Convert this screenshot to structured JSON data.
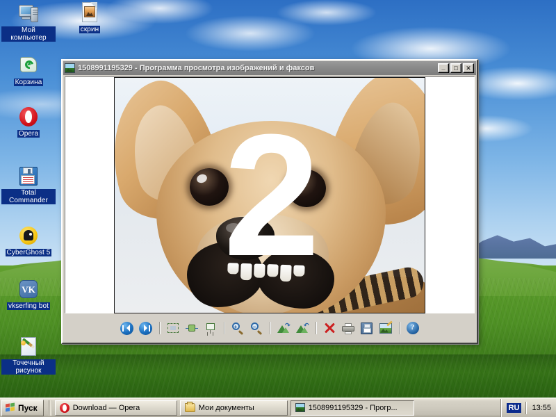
{
  "desktop": {
    "icons": [
      {
        "name": "my-computer",
        "label": "Мой компьютер",
        "icon": "computer-icon"
      },
      {
        "name": "recycle-bin",
        "label": "Корзина",
        "icon": "recycle-bin-icon"
      },
      {
        "name": "opera",
        "label": "Opera",
        "icon": "opera-icon"
      },
      {
        "name": "total-commander",
        "label": "Total Commander",
        "icon": "floppy-disk-icon"
      },
      {
        "name": "cyberghost",
        "label": "CyberGhost 5",
        "icon": "ghost-icon"
      },
      {
        "name": "vkserfing-bot",
        "label": "vkserfing bot",
        "icon": "vk-icon"
      },
      {
        "name": "bitmap-image",
        "label": "Точечный рисунок",
        "icon": "paint-brush-icon"
      },
      {
        "name": "screenshot-file",
        "label": "скрин",
        "icon": "image-file-icon"
      }
    ]
  },
  "viewer": {
    "title": "1508991195329 - Программа просмотра изображений и факсов",
    "title_icon": "picture-icon",
    "window_buttons": {
      "minimize": "_",
      "maximize": "□",
      "close": "✕"
    },
    "image": {
      "overlay_text": "2",
      "alt": "Чихуахуа крупным планом"
    },
    "toolbar": [
      {
        "name": "previous-image-button",
        "icon": "previous-icon",
        "tooltip": "Предыдущее изображение"
      },
      {
        "name": "next-image-button",
        "icon": "next-icon",
        "tooltip": "Следующее изображение"
      },
      {
        "name": "best-fit-button",
        "icon": "best-fit-icon",
        "tooltip": "Наилучшее соответствие"
      },
      {
        "name": "actual-size-button",
        "icon": "actual-size-icon",
        "tooltip": "Реальный размер"
      },
      {
        "name": "slideshow-button",
        "icon": "slideshow-icon",
        "tooltip": "Показ слайдов"
      },
      {
        "name": "zoom-in-button",
        "icon": "zoom-in-icon",
        "tooltip": "Увеличить"
      },
      {
        "name": "zoom-out-button",
        "icon": "zoom-out-icon",
        "tooltip": "Уменьшить"
      },
      {
        "name": "rotate-clockwise-button",
        "icon": "rotate-cw-icon",
        "tooltip": "Повернуть по часовой стрелке"
      },
      {
        "name": "rotate-counter-button",
        "icon": "rotate-ccw-icon",
        "tooltip": "Повернуть против часовой стрелки"
      },
      {
        "name": "delete-button",
        "icon": "delete-icon",
        "tooltip": "Удалить"
      },
      {
        "name": "print-button",
        "icon": "print-icon",
        "tooltip": "Печать"
      },
      {
        "name": "save-as-button",
        "icon": "save-icon",
        "tooltip": "Копировать в"
      },
      {
        "name": "edit-button",
        "icon": "edit-image-icon",
        "tooltip": "Изменить рисунок"
      },
      {
        "name": "help-button",
        "icon": "help-icon",
        "tooltip": "Справка"
      }
    ]
  },
  "taskbar": {
    "start_label": "Пуск",
    "start_icon": "windows-flag-icon",
    "tasks": [
      {
        "name": "taskbar-item-opera",
        "label": "Download — Opera",
        "icon": "opera-icon",
        "active": false
      },
      {
        "name": "taskbar-item-docs",
        "label": "Мои документы",
        "icon": "folder-icon",
        "active": false
      },
      {
        "name": "taskbar-item-viewer",
        "label": "1508991195329 - Прогр...",
        "icon": "picture-icon",
        "active": true
      }
    ],
    "tray": {
      "language": "RU",
      "clock": "13:55"
    }
  }
}
